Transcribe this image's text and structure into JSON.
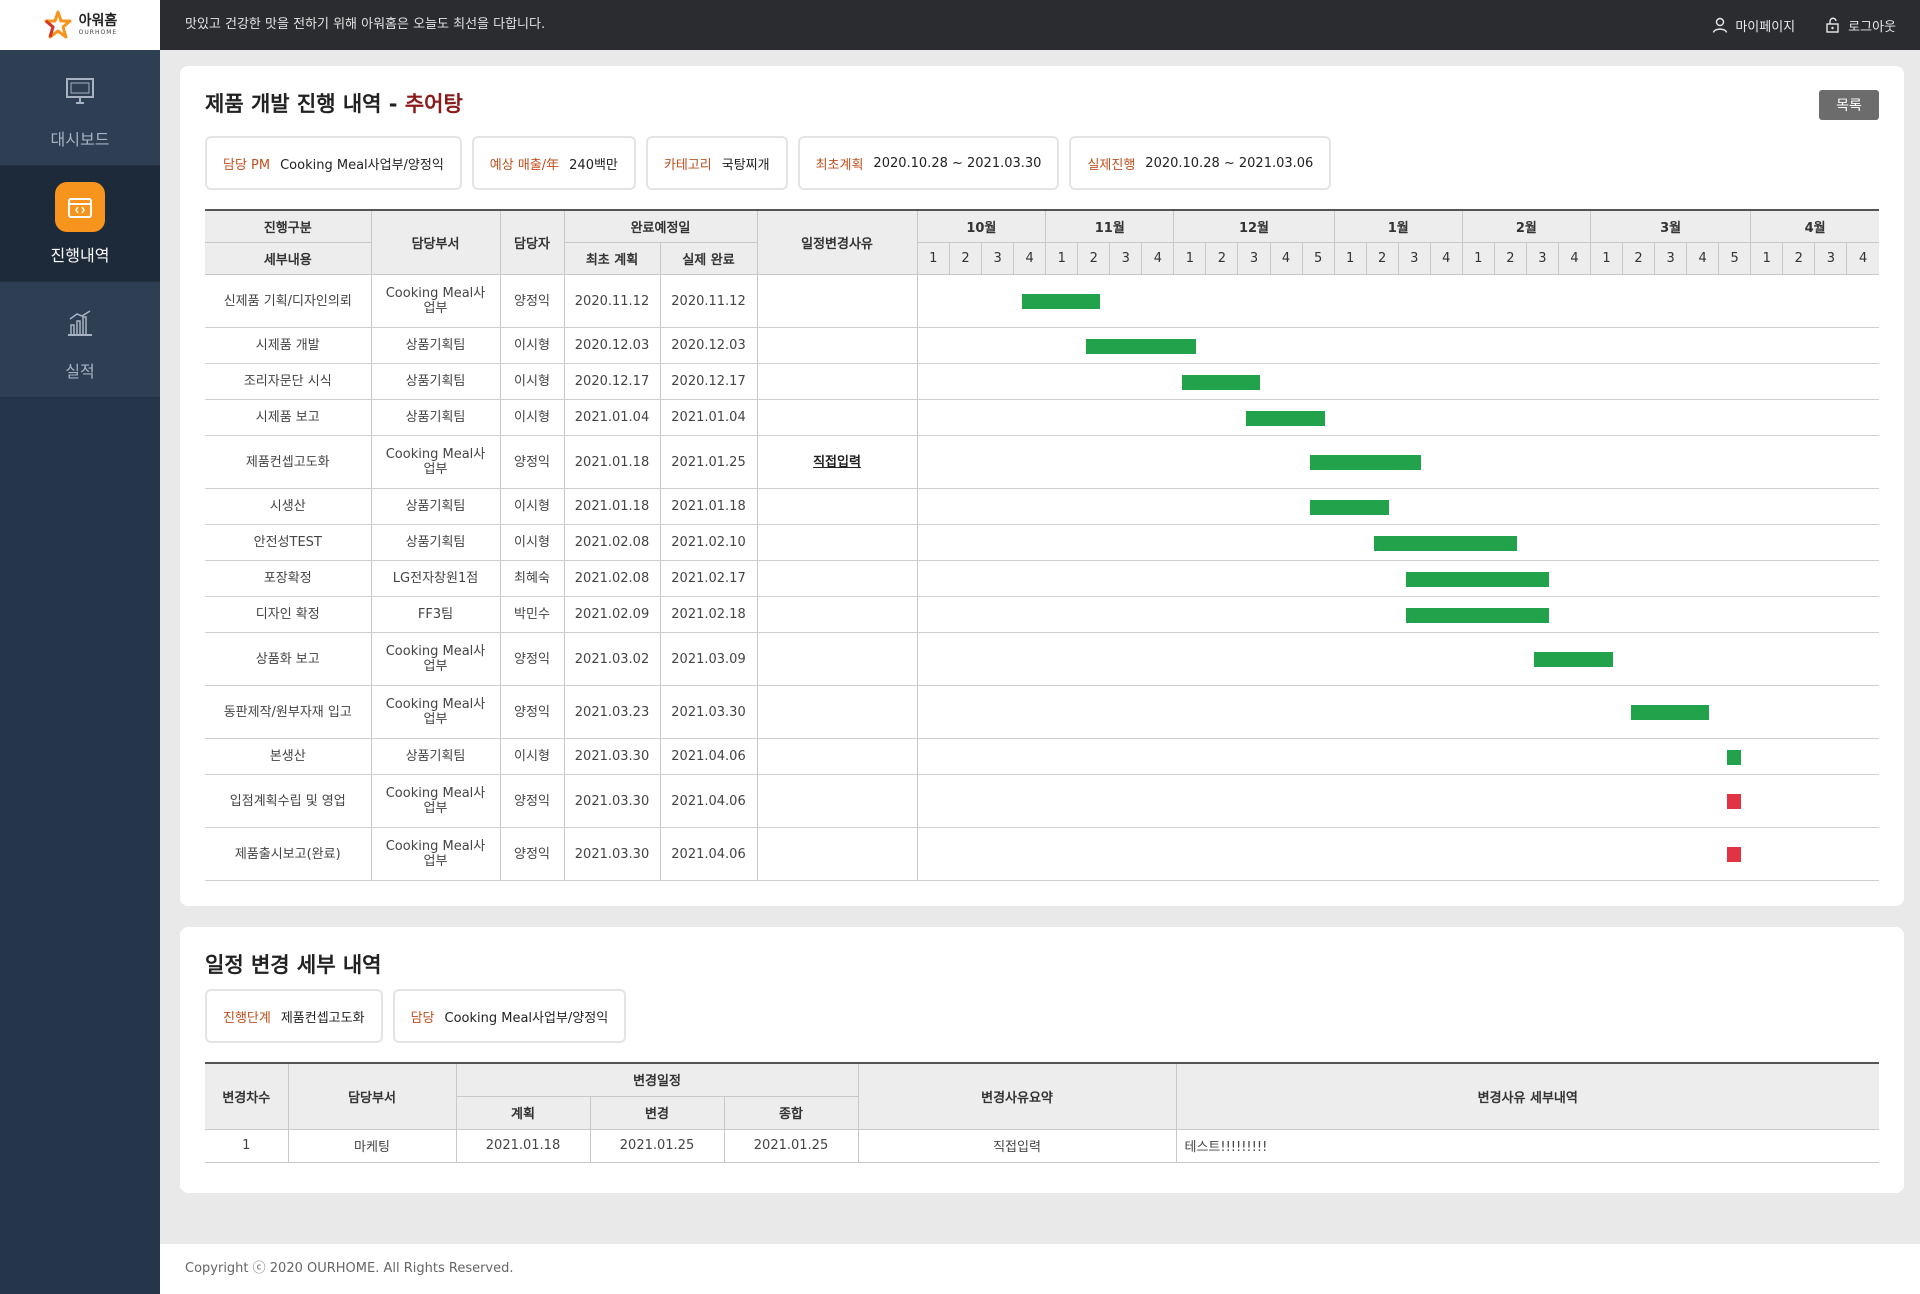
{
  "header": {
    "logo_ko": "아워홈",
    "logo_en": "OURHOME",
    "slogan": "맛있고 건강한 맛을 전하기 위해 아워홈은 오늘도 최선을 다합니다.",
    "mypage": "마이페이지",
    "logout": "로그아웃"
  },
  "sidebar": {
    "items": [
      {
        "label": "대시보드",
        "icon": "monitor-icon"
      },
      {
        "label": "진행내역",
        "icon": "history-icon"
      },
      {
        "label": "실적",
        "icon": "bar-chart-icon"
      }
    ]
  },
  "page": {
    "title_prefix": "제품 개발 진행 내역 - ",
    "title_product": "추어탕",
    "list_button": "목록"
  },
  "info": [
    {
      "label": "담당 PM",
      "value": "Cooking Meal사업부/양정익"
    },
    {
      "label": "예상 매출/年",
      "value": "240백만"
    },
    {
      "label": "카테고리",
      "value": "국탕찌개"
    },
    {
      "label": "최초계획",
      "value": "2020.10.28 ~ 2021.03.30"
    },
    {
      "label": "실제진행",
      "value": "2020.10.28 ~ 2021.03.06"
    }
  ],
  "gantt": {
    "headers": {
      "step": "진행구분",
      "detail": "세부내용",
      "dept": "담당부서",
      "person": "담당자",
      "due": "완료예정일",
      "plan": "최초 계획",
      "actual": "실제 완료",
      "reason": "일정변경사유"
    },
    "months": [
      {
        "label": "10월",
        "weeks": 4
      },
      {
        "label": "11월",
        "weeks": 4
      },
      {
        "label": "12월",
        "weeks": 5
      },
      {
        "label": "1월",
        "weeks": 4
      },
      {
        "label": "2월",
        "weeks": 4
      },
      {
        "label": "3월",
        "weeks": 5
      },
      {
        "label": "4월",
        "weeks": 4
      }
    ],
    "week_labels": [
      "1",
      "2",
      "3",
      "4",
      "1",
      "2",
      "3",
      "4",
      "1",
      "2",
      "3",
      "4",
      "5",
      "1",
      "2",
      "3",
      "4",
      "1",
      "2",
      "3",
      "4",
      "1",
      "2",
      "3",
      "4",
      "5",
      "1",
      "2",
      "3",
      "4"
    ],
    "colors": {
      "normal": "#22a24a",
      "delayed": "#e03444"
    },
    "rows": [
      {
        "detail": "신제품 기획/디자인의뢰",
        "dept": "Cooking Meal사업부",
        "person": "양정익",
        "plan": "2020.11.12",
        "actual": "2020.11.12",
        "reason": "",
        "start_week": 3.25,
        "end_week": 5.7,
        "status": "normal"
      },
      {
        "detail": "시제품 개발",
        "dept": "상품기획팀",
        "person": "이시형",
        "plan": "2020.12.03",
        "actual": "2020.12.03",
        "reason": "",
        "start_week": 5.25,
        "end_week": 8.7,
        "status": "normal"
      },
      {
        "detail": "조리자문단 시식",
        "dept": "상품기획팀",
        "person": "이시형",
        "plan": "2020.12.17",
        "actual": "2020.12.17",
        "reason": "",
        "start_week": 8.25,
        "end_week": 10.7,
        "status": "normal"
      },
      {
        "detail": "시제품 보고",
        "dept": "상품기획팀",
        "person": "이시형",
        "plan": "2021.01.04",
        "actual": "2021.01.04",
        "reason": "",
        "start_week": 10.25,
        "end_week": 12.7,
        "status": "normal"
      },
      {
        "detail": "제품컨셉고도화",
        "dept": "Cooking Meal사업부",
        "person": "양정익",
        "plan": "2021.01.18",
        "actual": "2021.01.25",
        "reason": "직접입력",
        "start_week": 12.25,
        "end_week": 15.7,
        "status": "normal"
      },
      {
        "detail": "시생산",
        "dept": "상품기획팀",
        "person": "이시형",
        "plan": "2021.01.18",
        "actual": "2021.01.18",
        "reason": "",
        "start_week": 12.25,
        "end_week": 14.7,
        "status": "normal"
      },
      {
        "detail": "안전성TEST",
        "dept": "상품기획팀",
        "person": "이시형",
        "plan": "2021.02.08",
        "actual": "2021.02.10",
        "reason": "",
        "start_week": 14.25,
        "end_week": 18.7,
        "status": "normal"
      },
      {
        "detail": "포장확정",
        "dept": "LG전자창원1점",
        "person": "최혜숙",
        "plan": "2021.02.08",
        "actual": "2021.02.17",
        "reason": "",
        "start_week": 15.25,
        "end_week": 19.7,
        "status": "normal"
      },
      {
        "detail": "디자인 확정",
        "dept": "FF3팀",
        "person": "박민수",
        "plan": "2021.02.09",
        "actual": "2021.02.18",
        "reason": "",
        "start_week": 15.25,
        "end_week": 19.7,
        "status": "normal"
      },
      {
        "detail": "상품화 보고",
        "dept": "Cooking Meal사업부",
        "person": "양정익",
        "plan": "2021.03.02",
        "actual": "2021.03.09",
        "reason": "",
        "start_week": 19.25,
        "end_week": 21.7,
        "status": "normal"
      },
      {
        "detail": "동판제작/원부자재 입고",
        "dept": "Cooking Meal사업부",
        "person": "양정익",
        "plan": "2021.03.23",
        "actual": "2021.03.30",
        "reason": "",
        "start_week": 22.25,
        "end_week": 24.7,
        "status": "normal"
      },
      {
        "detail": "본생산",
        "dept": "상품기획팀",
        "person": "이시형",
        "plan": "2021.03.30",
        "actual": "2021.04.06",
        "reason": "",
        "start_week": 25.25,
        "end_week": 25.7,
        "status": "normal"
      },
      {
        "detail": "입점계획수립 및 영업",
        "dept": "Cooking Meal사업부",
        "person": "양정익",
        "plan": "2021.03.30",
        "actual": "2021.04.06",
        "reason": "",
        "start_week": 25.25,
        "end_week": 25.7,
        "status": "delayed"
      },
      {
        "detail": "제품출시보고(완료)",
        "dept": "Cooking Meal사업부",
        "person": "양정익",
        "plan": "2021.03.30",
        "actual": "2021.04.06",
        "reason": "",
        "start_week": 25.25,
        "end_week": 25.7,
        "status": "delayed"
      }
    ]
  },
  "change_section": {
    "title": "일정 변경 세부 내역",
    "info": [
      {
        "label": "진행단계",
        "value": "제품컨셉고도화"
      },
      {
        "label": "담당",
        "value": "Cooking Meal사업부/양정익"
      }
    ],
    "headers": {
      "round": "변경차수",
      "dept": "담당부서",
      "schedule": "변경일정",
      "plan": "계획",
      "change": "변경",
      "total": "종합",
      "summary": "변경사유요약",
      "detail": "변경사유 세부내역"
    },
    "rows": [
      {
        "round": "1",
        "dept": "마케팅",
        "plan": "2021.01.18",
        "change": "2021.01.25",
        "total": "2021.01.25",
        "summary": "직접입력",
        "detail": "테스트!!!!!!!!!"
      }
    ]
  },
  "footer": {
    "copyright": "Copyright ⓒ 2020 OURHOME. All Rights Reserved."
  }
}
